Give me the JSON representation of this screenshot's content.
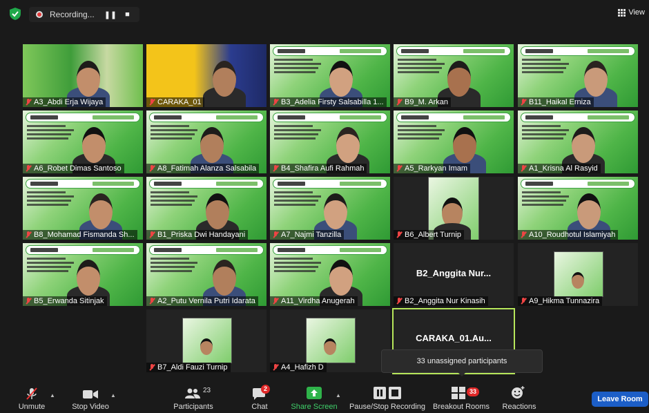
{
  "top_bar": {
    "recording_label": "Recording...",
    "pause_icon": "pause-icon",
    "stop_icon": "stop-icon",
    "view_label": "View"
  },
  "tiles": [
    {
      "name": "A3_Abdi Erja Wijaya",
      "kind": "camera"
    },
    {
      "name": "CARAKA_01",
      "kind": "camera"
    },
    {
      "name": "B3_Adelia Firsty Salsabilla 1...",
      "kind": "slide"
    },
    {
      "name": "B9_M. Arkan",
      "kind": "slide"
    },
    {
      "name": "B11_Haikal Erniza",
      "kind": "slide"
    },
    {
      "name": "A6_Robet Dimas Santoso",
      "kind": "slide"
    },
    {
      "name": "A8_Fatimah Alanza Salsabila",
      "kind": "slide"
    },
    {
      "name": "B4_Shafira Aufi Rahmah",
      "kind": "slide"
    },
    {
      "name": "A5_Rarkyan Imam",
      "kind": "slide"
    },
    {
      "name": "A1_Krisna Al Rasyid",
      "kind": "slide"
    },
    {
      "name": "B8_Mohamad Fismanda Sh...",
      "kind": "slide"
    },
    {
      "name": "B1_Priska Dwi Handayani",
      "kind": "slide"
    },
    {
      "name": "A7_Najmi Tanzilla",
      "kind": "slide"
    },
    {
      "name": "B6_Albert Turnip",
      "kind": "dark-slide"
    },
    {
      "name": "A10_Roudhotul Islamiyah",
      "kind": "slide"
    },
    {
      "name": "B5_Erwanda Sitinjak",
      "kind": "slide"
    },
    {
      "name": "A2_Putu Vernila Putri Idarata",
      "kind": "slide"
    },
    {
      "name": "A11_Virdha Anugerah",
      "kind": "slide"
    },
    {
      "name": "B2_Anggita Nur Kinasih",
      "kind": "dark",
      "big_name": "B2_Anggita Nur..."
    },
    {
      "name": "A9_Hikma Tunnazira",
      "kind": "dark-mini"
    },
    {
      "name": "B7_Aldi Fauzi Turnip",
      "kind": "dark-mini"
    },
    {
      "name": "A4_Hafizh D",
      "kind": "dark-mini"
    },
    {
      "name": "",
      "kind": "dark-active",
      "big_name": "CARAKA_01.Au..."
    }
  ],
  "tooltip": "33 unassigned participants",
  "toolbar": {
    "unmute": "Unmute",
    "stop_video": "Stop Video",
    "participants": "Participants",
    "participants_count": "23",
    "chat": "Chat",
    "chat_badge": "2",
    "share_screen": "Share Screen",
    "record": "Pause/Stop Recording",
    "breakout": "Breakout Rooms",
    "breakout_badge": "33",
    "reactions": "Reactions",
    "leave": "Leave Room"
  },
  "colors": {
    "accent_green": "#b7e75b",
    "share_green": "#2fb34a",
    "leave_blue": "#1c5ec7",
    "badge_red": "#e02828"
  }
}
